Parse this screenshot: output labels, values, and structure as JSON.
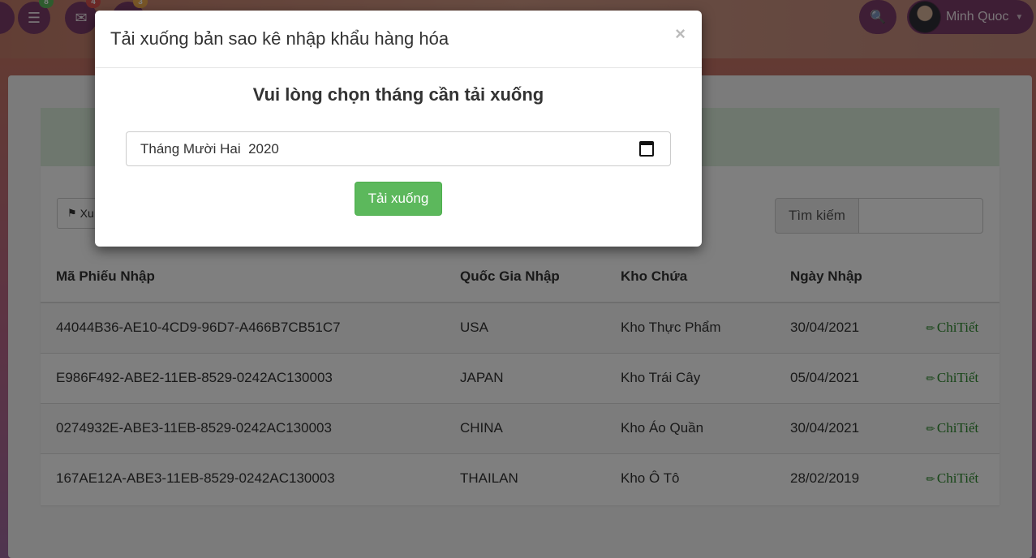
{
  "topbar": {
    "nav": [
      {
        "icon": "server-icon",
        "glyph": "☰",
        "badge": "8",
        "badge_color": "#5cb85c"
      },
      {
        "icon": "envelope-icon",
        "glyph": "✉",
        "badge": "4",
        "badge_color": "#d9534f"
      },
      {
        "icon": "bell-icon",
        "glyph": "♪",
        "badge": "3",
        "badge_color": "#f0ad4e"
      }
    ],
    "search_glyph": "🔍",
    "user_name": "Minh Quoc",
    "caret": "▼"
  },
  "page": {
    "export_label": "Xu",
    "search_label": "Tìm kiếm",
    "table": {
      "headers": [
        "Mã Phiếu Nhập",
        "Quốc Gia Nhập",
        "Kho Chứa",
        "Ngày Nhập",
        ""
      ],
      "rows": [
        [
          "44044B36-AE10-4CD9-96D7-A466B7CB51C7",
          "USA",
          "Kho Thực Phẩm",
          "30/04/2021",
          "ChiTiết"
        ],
        [
          "E986F492-ABE2-11EB-8529-0242AC130003",
          "JAPAN",
          "Kho Trái Cây",
          "05/04/2021",
          "ChiTiết"
        ],
        [
          "0274932E-ABE3-11EB-8529-0242AC130003",
          "CHINA",
          "Kho Áo Quần",
          "30/04/2021",
          "ChiTiết"
        ],
        [
          "167AE12A-ABE3-11EB-8529-0242AC130003",
          "THAILAN",
          "Kho Ô Tô",
          "28/02/2019",
          "ChiTiết"
        ]
      ]
    }
  },
  "modal": {
    "title": "Tải xuống bản sao kê nhập khẩu hàng hóa",
    "close": "×",
    "heading": "Vui lòng chọn tháng cần tải xuống",
    "month_value": "Tháng Mười Hai  2020",
    "download_label": "Tải xuống"
  },
  "colors": {
    "success": "#5cb85c",
    "nav_purple": "#7c3d6b",
    "link_green": "#2e8b2e"
  }
}
